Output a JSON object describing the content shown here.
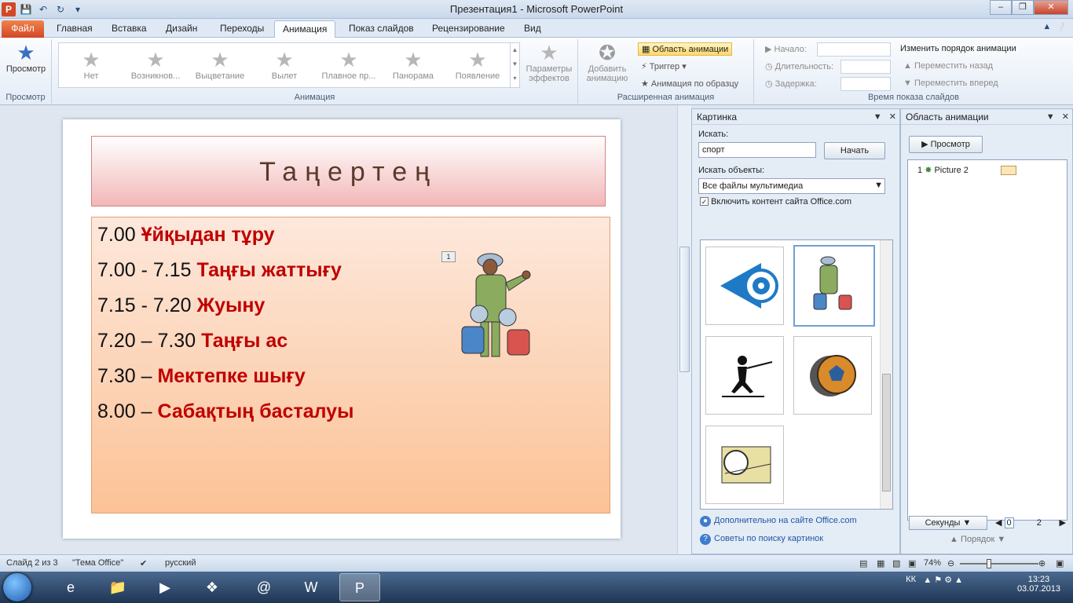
{
  "title_bar": {
    "title": "Презентация1  -  Microsoft PowerPoint",
    "app_icon": "P"
  },
  "tabs": [
    "Файл",
    "Главная",
    "Вставка",
    "Дизайн",
    "Переходы",
    "Анимация",
    "Показ слайдов",
    "Рецензирование",
    "Вид"
  ],
  "ribbon": {
    "preview_label": "Просмотр",
    "preview_group": "Просмотр",
    "animations": [
      "Нет",
      "Возникнов...",
      "Выцветание",
      "Вылет",
      "Плавное пр...",
      "Панорама",
      "Появление"
    ],
    "effect_params": "Параметры эффектов",
    "animation_group": "Анимация",
    "add_animation": "Добавить анимацию",
    "animation_pane": "Область анимации",
    "trigger": "Триггер",
    "anim_painter": "Анимация по образцу",
    "advanced_group": "Расширенная анимация",
    "start_label": "Начало:",
    "duration_label": "Длительность:",
    "delay_label": "Задержка:",
    "reorder_title": "Изменить порядок анимации",
    "move_earlier": "Переместить назад",
    "move_later": "Переместить вперед",
    "timing_group": "Время показа слайдов"
  },
  "slide": {
    "title": "Таңертең",
    "lines": [
      {
        "time": "7.00  ",
        "text": "Ұйқыдан тұру"
      },
      {
        "time": " 7.00 - 7.15 ",
        "text": "Таңғы жаттығу"
      },
      {
        "time": "7.15 - 7.20 ",
        "text": "Жуыну"
      },
      {
        "time": "7.20 – 7.30 ",
        "text": "Таңғы ас"
      },
      {
        "time": "7.30 – ",
        "text": "Мектепке шығу"
      },
      {
        "time": "8.00 – ",
        "text": "Сабақтың басталуы"
      }
    ],
    "anim_tag": "1"
  },
  "clipart_panel": {
    "title": "Картинка",
    "search_label": "Искать:",
    "search_value": "спорт",
    "go_button": "Начать",
    "results_label": "Искать объекты:",
    "results_select": "Все файлы мультимедиа",
    "include_office": "Включить контент сайта Office.com",
    "more_link": "Дополнительно на сайте Office.com",
    "tips_link": "Советы по поиску картинок"
  },
  "anim_pane": {
    "title": "Область анимации",
    "play_button": "Просмотр",
    "item_index": "1",
    "item_name": "Picture 2",
    "seconds_label": "Секунды",
    "timeline_start": "0",
    "timeline_end": "2",
    "reorder_label": "Порядок"
  },
  "status": {
    "slide": "Слайд 2 из 3",
    "theme": "\"Тема Office\"",
    "lang": "русский",
    "zoom": "74%"
  },
  "tray": {
    "lang": "КК",
    "time": "13:23",
    "date": "03.07.2013"
  }
}
